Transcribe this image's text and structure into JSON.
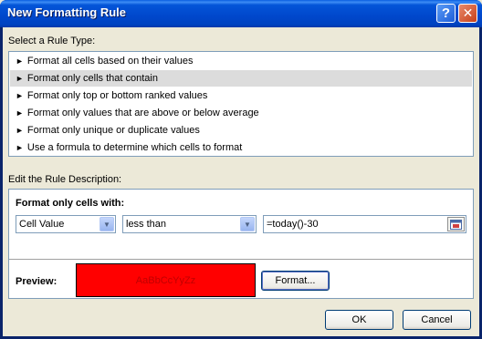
{
  "window": {
    "title": "New Formatting Rule",
    "help_glyph": "?",
    "close_glyph": "✕"
  },
  "rule_type": {
    "label": "Select a Rule Type:",
    "selected_index": 1,
    "items": [
      {
        "label": "Format all cells based on their values"
      },
      {
        "label": "Format only cells that contain"
      },
      {
        "label": "Format only top or bottom ranked values"
      },
      {
        "label": "Format only values that are above or below average"
      },
      {
        "label": "Format only unique or duplicate values"
      },
      {
        "label": "Use a formula to determine which cells to format"
      }
    ],
    "arrow_glyph": "►"
  },
  "description": {
    "label": "Edit the Rule Description:",
    "format_only_label": "Format only cells with:",
    "condition_source": "Cell Value",
    "operator": "less than",
    "value": "=today()-30",
    "dropdown_glyph": "▼",
    "preview_label": "Preview:",
    "preview_sample": "AaBbCcYyZz",
    "preview_fill_color": "#ff0000",
    "preview_text_color": "#c00000",
    "format_button": "Format..."
  },
  "footer": {
    "ok": "OK",
    "cancel": "Cancel"
  }
}
